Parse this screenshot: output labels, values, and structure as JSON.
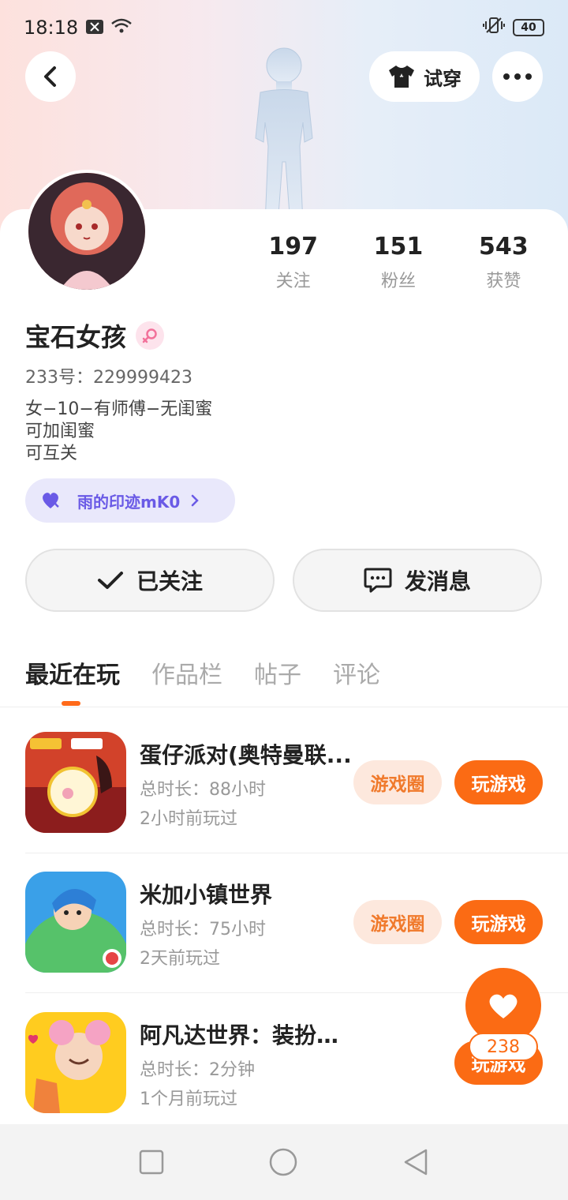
{
  "status_bar": {
    "time": "18:18",
    "battery": "40"
  },
  "header": {
    "try_on_label": "试穿"
  },
  "profile": {
    "name": "宝石女孩",
    "uid": "233号：229999423",
    "bio_lines": [
      "女−10−有师傅−无闺蜜",
      "可加闺蜜",
      "可互关"
    ],
    "tag_label": "雨的印迹mK0"
  },
  "stats": [
    {
      "value": "197",
      "label": "关注"
    },
    {
      "value": "151",
      "label": "粉丝"
    },
    {
      "value": "543",
      "label": "获赞"
    }
  ],
  "actions": {
    "follow_label": "已关注",
    "message_label": "发消息"
  },
  "tabs": [
    "最近在玩",
    "作品栏",
    "帖子",
    "评论"
  ],
  "games": [
    {
      "title": "蛋仔派对(奥特曼联...",
      "duration": "总时长：88小时",
      "last_played": "2小时前玩过",
      "circle_label": "游戏圈",
      "play_label": "玩游戏"
    },
    {
      "title": "米加小镇世界",
      "duration": "总时长：75小时",
      "last_played": "2天前玩过",
      "circle_label": "游戏圈",
      "play_label": "玩游戏"
    },
    {
      "title": "阿凡达世界：装扮生活",
      "duration": "总时长：2分钟",
      "last_played": "1个月前玩过",
      "play_label": "玩游戏"
    }
  ],
  "like_fab": {
    "count": "238"
  },
  "colors": {
    "accent": "#fb6b14",
    "tag_purple": "#6a5ae6"
  }
}
